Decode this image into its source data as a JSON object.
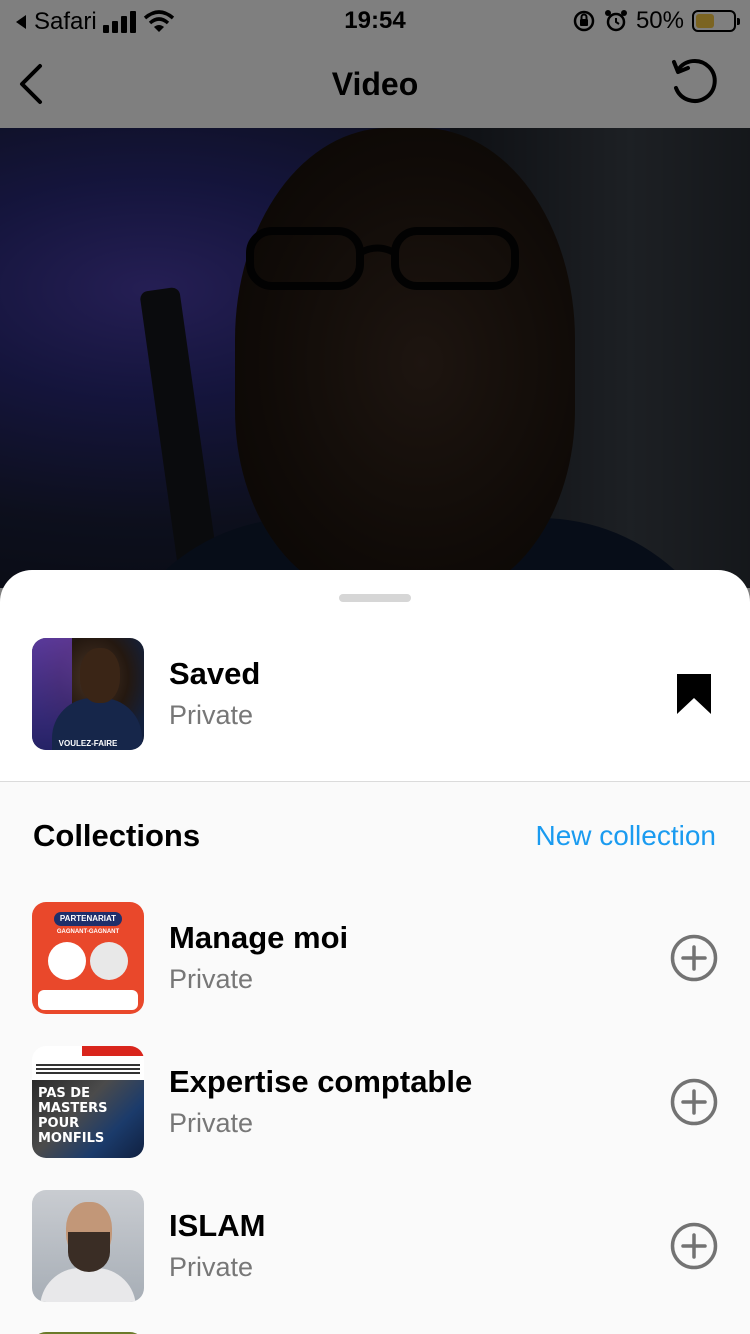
{
  "status_bar": {
    "back_app": "Safari",
    "time": "19:54",
    "battery": "50%",
    "battery_level": 0.5,
    "battery_color": "#f7c843"
  },
  "nav": {
    "title": "Video",
    "back_icon": "chevron-left-icon",
    "refresh_icon": "rotate-ccw-icon"
  },
  "sheet": {
    "saved": {
      "title": "Saved",
      "subtitle": "Private",
      "thumb_caption": "VOULEZ-FAIRE",
      "icon": "bookmark-filled-icon"
    },
    "collections": {
      "header": "Collections",
      "new_label": "New collection",
      "accent_color": "#1a9bf0",
      "items": [
        {
          "title": "Manage moi",
          "subtitle": "Private",
          "thumb_badge": "PARTENARIAT",
          "thumb_sub": "GAGNANT-GAGNANT",
          "icon": "plus-circle-icon"
        },
        {
          "title": "Expertise comptable",
          "subtitle": "Private",
          "thumb_text": "PAS DE MASTERS POUR MONFILS",
          "icon": "plus-circle-icon"
        },
        {
          "title": "ISLAM",
          "subtitle": "Private",
          "icon": "plus-circle-icon"
        }
      ]
    }
  }
}
